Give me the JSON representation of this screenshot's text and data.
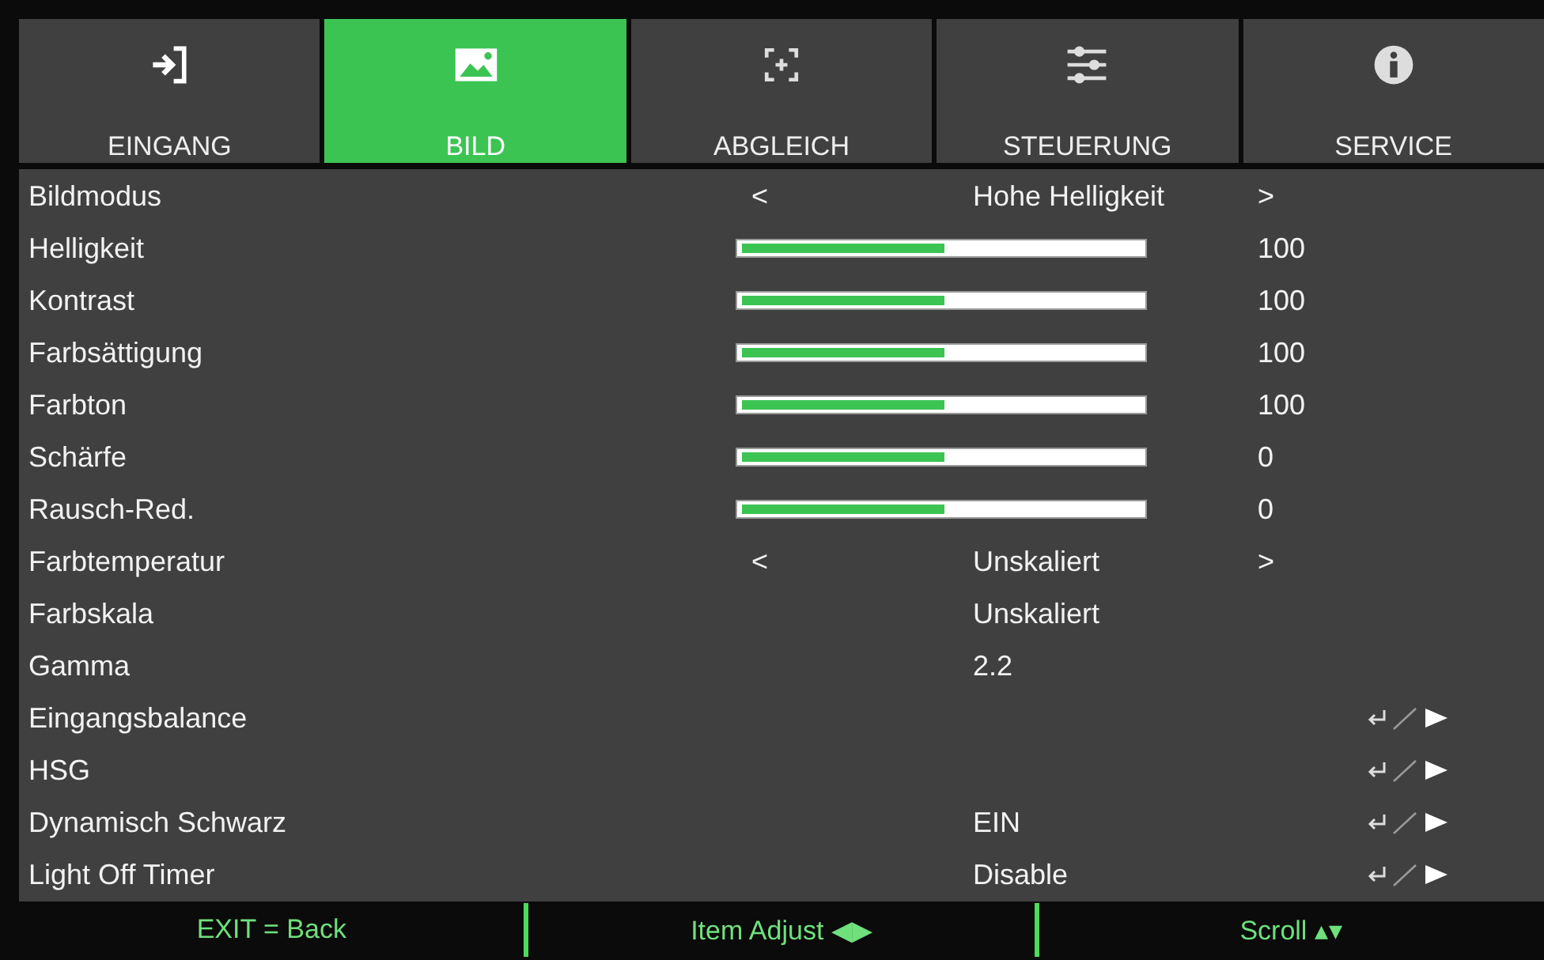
{
  "tabs": [
    {
      "label": "EINGANG",
      "kind": "input",
      "selected": false
    },
    {
      "label": "BILD",
      "kind": "image",
      "selected": true
    },
    {
      "label": "ABGLEICH",
      "kind": "focus",
      "selected": false
    },
    {
      "label": "STEUERUNG",
      "kind": "sliders",
      "selected": false
    },
    {
      "label": "SERVICE",
      "kind": "info",
      "selected": false
    }
  ],
  "rows": [
    {
      "kind": "select",
      "label": "Bildmodus",
      "value": "Hohe Helligkeit",
      "left": "<",
      "right": ">"
    },
    {
      "kind": "slider",
      "label": "Helligkeit",
      "level": 0.5,
      "reading": "100"
    },
    {
      "kind": "slider",
      "label": "Kontrast",
      "level": 0.5,
      "reading": "100"
    },
    {
      "kind": "slider",
      "label": "Farbsättigung",
      "level": 0.5,
      "reading": "100"
    },
    {
      "kind": "slider",
      "label": "Farbton",
      "level": 0.5,
      "reading": "100"
    },
    {
      "kind": "slider",
      "label": "Schärfe",
      "level": 0.5,
      "reading": "0"
    },
    {
      "kind": "slider",
      "label": "Rausch-Red.",
      "level": 0.5,
      "reading": "0"
    },
    {
      "kind": "select",
      "label": "Farbtemperatur",
      "value": "Unskaliert",
      "left": "<",
      "right": ">"
    },
    {
      "kind": "value",
      "label": "Farbskala",
      "value": "Unskaliert"
    },
    {
      "kind": "value",
      "label": "Gamma",
      "value": "2.2"
    },
    {
      "kind": "submenu",
      "label": "Eingangsbalance"
    },
    {
      "kind": "submenu",
      "label": "HSG"
    },
    {
      "kind": "submenu",
      "label": "Dynamisch Schwarz",
      "value": "EIN"
    },
    {
      "kind": "submenu",
      "label": "Light Off Timer",
      "value": "Disable"
    }
  ],
  "footer": [
    "EXIT = Back",
    "Item Adjust ◀▶",
    "Scroll ▴▾"
  ]
}
